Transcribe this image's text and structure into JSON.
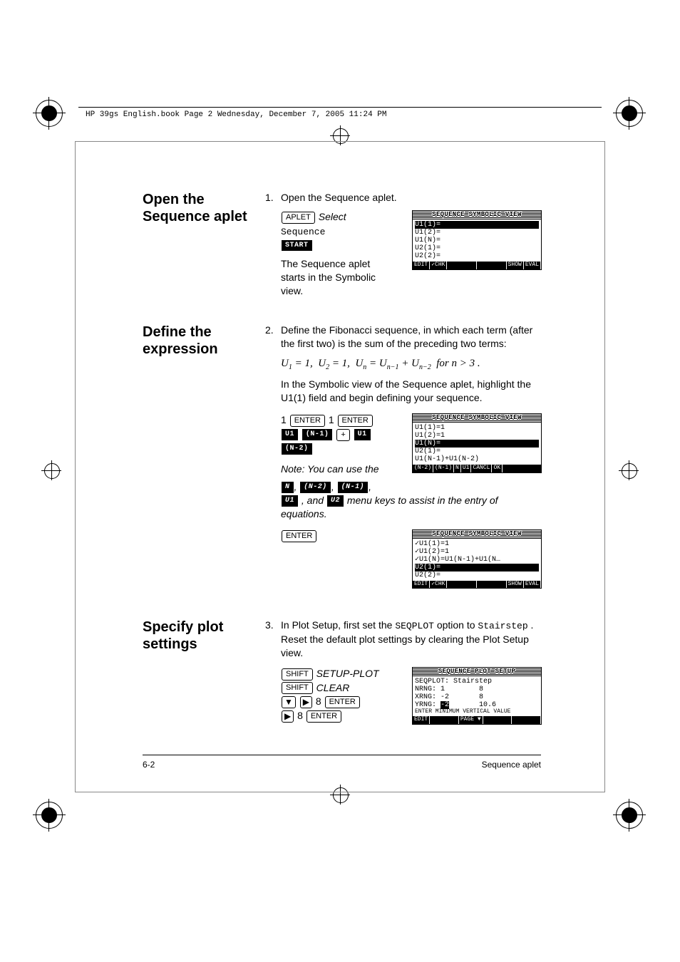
{
  "header": {
    "book_info": "HP 39gs English.book  Page 2  Wednesday, December 7, 2005  11:24 PM"
  },
  "sections": {
    "s1": {
      "title": "Open the Sequence aplet",
      "step_num": "1.",
      "step_text": "Open the Sequence aplet.",
      "key_aplet": "APLET",
      "select_label": "Select",
      "sequence_label": "Sequence",
      "softkey_start": "START",
      "desc": "The Sequence aplet starts in the Symbolic view.",
      "screenshot": {
        "title": "SEQUENCE SYMBOLIC VIEW",
        "rows": [
          "U1(1)=",
          "U1(2)=",
          "U1(N)=",
          "U2(1)=",
          "U2(2)="
        ],
        "menu": [
          "EDIT",
          "✓CHK",
          "",
          "",
          "SHOW",
          "EVAL"
        ]
      }
    },
    "s2": {
      "title": "Define the expression",
      "step_num": "2.",
      "step_text": "Define the Fibonacci sequence, in which each term (after the first two) is the sum of the preceding two terms:",
      "formula_prefix": "U",
      "formula_text_plain": "U₁ = 1,  U₂ = 1,  Uₙ = Uₙ₋₁ + Uₙ₋₂  for n > 3 .",
      "para2": "In the Symbolic view of the Sequence aplet, highlight the U1(1) field and begin defining your sequence.",
      "key_enter": "ENTER",
      "key_one": "1",
      "sk_u1": "U1",
      "sk_n1": "(N-1)",
      "sk_plus": "+",
      "sk_n2": "(N-2)",
      "note": "Note: You can use the",
      "sk_n": "N",
      "note2": ", and ",
      "sk_u2": "U2",
      "note3": " menu keys to assist in the entry of equations.",
      "screenshot1": {
        "title": "SEQUENCE SYMBOLIC VIEW",
        "rows": [
          "U1(1)=1",
          "U1(2)=1",
          "U1(N)=",
          "U2(1)=",
          "U1(N-1)+U1(N-2)"
        ],
        "highlight_idx": 2,
        "menu": [
          "(N-2)",
          "(N-1)",
          "N",
          "U1",
          "CANCL",
          "OK"
        ]
      },
      "screenshot2": {
        "title": "SEQUENCE SYMBOLIC VIEW",
        "rows": [
          "✓U1(1)=1",
          "✓U1(2)=1",
          "✓U1(N)=U1(N-1)+U1(N…",
          "U2(1)=",
          "U2(2)="
        ],
        "highlight_idx": 3,
        "menu": [
          "EDIT",
          "✓CHK",
          "",
          "",
          "SHOW",
          "EVAL"
        ]
      }
    },
    "s3": {
      "title": "Specify plot settings",
      "step_num": "3.",
      "step_text_a": "In Plot Setup, first set the ",
      "seqplot": "SEQPLOT",
      "step_text_b": " option to ",
      "stairstep": "Stairstep",
      "step_text_c": ". Reset the default plot settings by clearing the Plot Setup view.",
      "key_shift": "SHIFT",
      "label_setup_plot": "SETUP-PLOT",
      "label_clear": "CLEAR",
      "key_down": "▼",
      "key_right": "▶",
      "key_8": "8",
      "key_enter": "ENTER",
      "screenshot": {
        "title": "SEQUENCE PLOT SETUP",
        "rows": [
          "SEQPLOT: Stairstep",
          "NRNG: 1        8",
          "XRNG: -2       8",
          "YRNG: -2       10.6",
          "",
          "ENTER MINIMUM VERTICAL VALUE"
        ],
        "yrng_hl": "-2",
        "menu": [
          "EDIT",
          "",
          "PAGE ▼",
          "",
          ""
        ]
      }
    }
  },
  "footer": {
    "left": "6-2",
    "right": "Sequence aplet"
  }
}
